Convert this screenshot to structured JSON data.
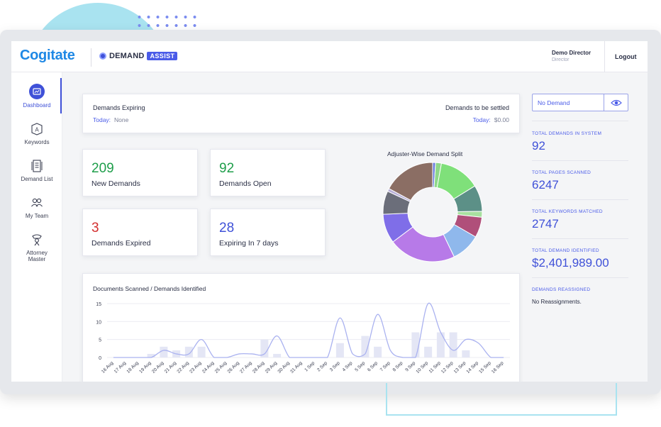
{
  "header": {
    "brand": "Cogitate",
    "product_name": "DEMAND",
    "product_tag": "ASSIST",
    "user_name": "Demo Director",
    "user_role": "Director",
    "logout_label": "Logout"
  },
  "sidebar": {
    "items": [
      {
        "label": "Dashboard",
        "icon": "dashboard-icon",
        "active": true
      },
      {
        "label": "Keywords",
        "icon": "keyword-icon",
        "active": false
      },
      {
        "label": "Demand List",
        "icon": "demand-list-icon",
        "active": false
      },
      {
        "label": "My Team",
        "icon": "team-icon",
        "active": false
      },
      {
        "label": "Attorney Master",
        "icon": "attorney-icon",
        "active": false
      }
    ]
  },
  "expiry": {
    "left_title": "Demands Expiring",
    "left_key": "Today:",
    "left_value": "None",
    "right_title": "Demands to be settled",
    "right_key": "Today:",
    "right_value": "$0.00"
  },
  "stats": [
    {
      "value": "209",
      "label": "New Demands",
      "color": "#1e9e4a"
    },
    {
      "value": "92",
      "label": "Demands Open",
      "color": "#1e9e4a"
    },
    {
      "value": "3",
      "label": "Demands Expired",
      "color": "#d32f2f"
    },
    {
      "value": "28",
      "label": "Expiring In 7 days",
      "color": "#3f51d8"
    }
  ],
  "pie_chart": {
    "title": "Adjuster-Wise Demand Split",
    "slices": [
      {
        "value": 1,
        "color": "#6d7fe0"
      },
      {
        "value": 2,
        "color": "#8fd88a"
      },
      {
        "value": 14,
        "color": "#7fe07a"
      },
      {
        "value": 9,
        "color": "#5c9087"
      },
      {
        "value": 2,
        "color": "#a8e0a0"
      },
      {
        "value": 7,
        "color": "#b04f7a"
      },
      {
        "value": 10,
        "color": "#8fb8ec"
      },
      {
        "value": 23,
        "color": "#b77ae8"
      },
      {
        "value": 10,
        "color": "#7f6ee8"
      },
      {
        "value": 8,
        "color": "#6b6e7a"
      },
      {
        "value": 1,
        "color": "#b8b0d8"
      },
      {
        "value": 18,
        "color": "#8b6e64"
      }
    ]
  },
  "chart_data": {
    "type": "bar",
    "title": "Documents Scanned / Demands Identified",
    "categories": [
      "16 Aug",
      "17 Aug",
      "18 Aug",
      "19 Aug",
      "20 Aug",
      "21 Aug",
      "22 Aug",
      "23 Aug",
      "24 Aug",
      "25 Aug",
      "26 Aug",
      "27 Aug",
      "28 Aug",
      "29 Aug",
      "30 Aug",
      "31 Aug",
      "1 Sep",
      "2 Sep",
      "3 Sep",
      "4 Sep",
      "5 Sep",
      "6 Sep",
      "7 Sep",
      "8 Sep",
      "9 Sep",
      "10 Sep",
      "11 Sep",
      "12 Sep",
      "13 Sep",
      "14 Sep",
      "15 Sep",
      "16 Sep"
    ],
    "series": [
      {
        "type": "bar",
        "values": [
          0,
          0,
          0,
          1,
          3,
          2,
          3,
          3,
          0,
          0,
          0,
          0,
          5,
          1,
          0,
          0,
          0,
          0,
          4,
          0,
          6,
          3,
          0,
          0,
          7,
          3,
          7,
          7,
          2,
          0,
          0,
          0
        ]
      },
      {
        "type": "line",
        "values": [
          0,
          0,
          0,
          0,
          2,
          1,
          1,
          5,
          0,
          0,
          1,
          1,
          1,
          6,
          0,
          0,
          0,
          0,
          11,
          1,
          1,
          12,
          2,
          0,
          0,
          15,
          7,
          2,
          5,
          4,
          0,
          0
        ]
      }
    ],
    "ylim": [
      0,
      15
    ],
    "yticks": [
      0,
      5,
      10,
      15
    ],
    "colors": {
      "bar": "#e4e6f5",
      "line": "#aab2f0",
      "grid": "#ececf2"
    }
  },
  "right_panel": {
    "dropdown_value": "No Demand",
    "metrics": [
      {
        "label": "TOTAL DEMANDS IN SYSTEM",
        "value": "92"
      },
      {
        "label": "TOTAL PAGES SCANNED",
        "value": "6247"
      },
      {
        "label": "TOTAL KEYWORDS MATCHED",
        "value": "2747"
      },
      {
        "label": "TOTAL DEMAND IDENTIFIED",
        "value": "$2,401,989.00"
      }
    ],
    "reassigned_label": "DEMANDS REASSIGNED",
    "reassigned_value": "No Reassignments."
  }
}
